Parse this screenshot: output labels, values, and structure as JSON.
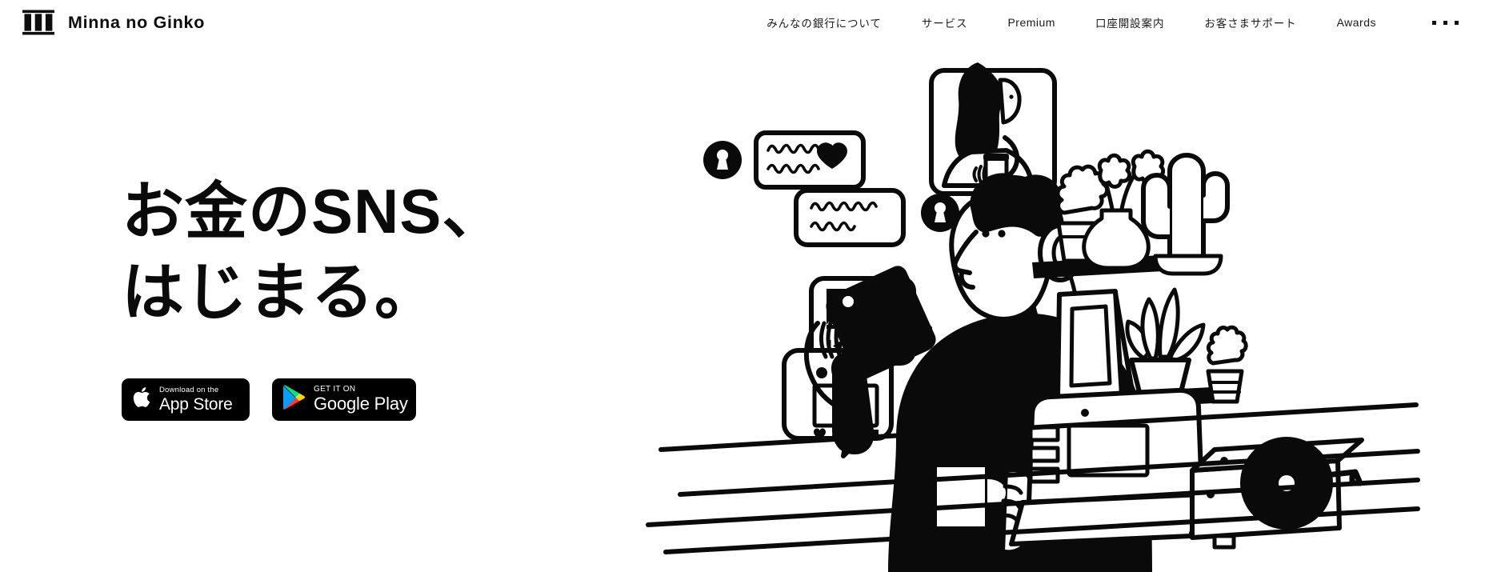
{
  "header": {
    "logo_icon": "bank-pillars-icon",
    "brand_name": "Minna no Ginko",
    "nav_items": [
      {
        "label": "みんなの銀行について",
        "name": "nav-about",
        "latin": false
      },
      {
        "label": "サービス",
        "name": "nav-service",
        "latin": false
      },
      {
        "label": "Premium",
        "name": "nav-premium",
        "latin": true
      },
      {
        "label": "口座開設案内",
        "name": "nav-account-opening",
        "latin": false
      },
      {
        "label": "お客さまサポート",
        "name": "nav-support",
        "latin": false
      },
      {
        "label": "Awards",
        "name": "nav-awards",
        "latin": true
      }
    ],
    "more_menu_icon": "more-dots-icon"
  },
  "hero": {
    "headline_line1": "お金のSNS、",
    "headline_line2": "はじまる。",
    "badges": {
      "apple": {
        "icon": "apple-logo-icon",
        "top_text": "Download on the",
        "main_text": "App Store"
      },
      "google": {
        "icon": "google-play-icon",
        "top_text": "GET IT ON",
        "main_text": "Google Play"
      }
    }
  },
  "illustration": {
    "name": "hero-illustration",
    "description_elements": [
      "lock-badge-icon",
      "chat-bubble-scribble",
      "heart-icon",
      "video-call-bubble-woman-with-coffee",
      "media-player-bubble",
      "person-with-headphones-holding-phone-and-mug",
      "photo-player-bubble",
      "shelf-with-plants",
      "shelf-with-picture-frame-and-plants",
      "laptop",
      "record-player-turntable",
      "desk-lines"
    ]
  },
  "colors": {
    "background": "#ffffff",
    "ink": "#0a0a0a",
    "badge_bg": "#000000",
    "google_play_blue": "#00A0FF",
    "google_play_green": "#00E676",
    "google_play_yellow": "#FFD600",
    "google_play_red": "#FF3A44"
  }
}
